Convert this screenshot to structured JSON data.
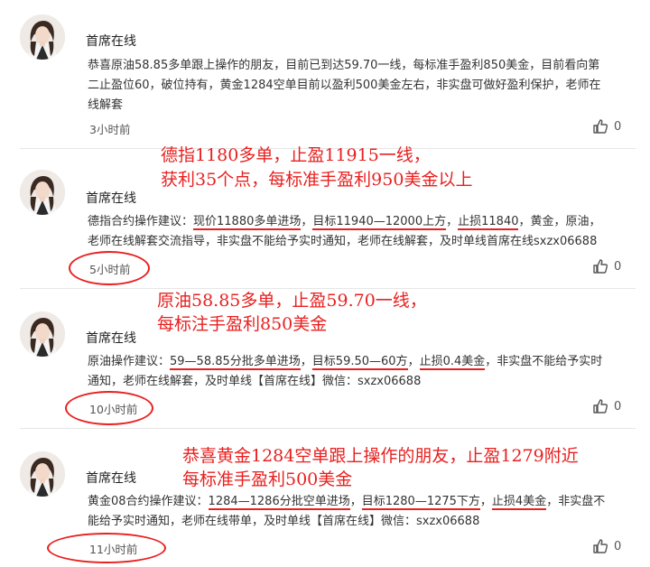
{
  "posts": [
    {
      "author": "首席在线",
      "lines": [
        "恭喜原油58.85多单跟上操作的朋友，目前已到达59.70一线，每标准手盈利850美金，目前看向第",
        "二止盈位60，破位持有，黄金1284空单目前以盈利500美金左右，非实盘可做好盈利保护，老师在",
        "线解套"
      ],
      "time": "3小时前",
      "likes": "0"
    },
    {
      "author": "首席在线",
      "annotation": [
        "德指1180多单，止盈11915一线，",
        "获利35个点，每标准手盈利950美金以上"
      ],
      "line1": {
        "a": "德指合约操作建议：",
        "u1": "现价11880多单进场",
        "b": "，",
        "u2": "目标11940—12000上方",
        "c": "，",
        "u3": "止损11840",
        "d": "，黄金，原油，"
      },
      "line2": "老师在线解套交流指导，非实盘不能给予实时通知，老师在线解套，及时单线首席在线sxzx06688",
      "time": "5小时前",
      "likes": "0"
    },
    {
      "author": "首席在线",
      "annotation": [
        "原油58.85多单，止盈59.70一线，",
        "每标注手盈利850美金"
      ],
      "line1": {
        "a": "原油操作建议：",
        "u1": "59—58.85分批多单进场",
        "b": "，",
        "u2": "目标59.50—60方",
        "c": "，",
        "u3": "止损0.4美金",
        "d": "，非实盘不能给予实时"
      },
      "line2": "通知，老师在线解套，及时单线【首席在线】微信：sxzx06688",
      "time": "10小时前",
      "likes": "0"
    },
    {
      "author": "首席在线",
      "annotation": [
        "恭喜黄金1284空单跟上操作的朋友，止盈1279附近",
        "每标准手盈利500美金"
      ],
      "line1": {
        "a": "黄金08合约操作建议：",
        "u1": "1284—1286分批空单进场",
        "b": "，",
        "u2": "目标1280—1275下方",
        "c": "，",
        "u3": "止损4美金",
        "d": "，非实盘不"
      },
      "line2": "能给予实时通知，老师在线带单，及时单线【首席在线】微信：sxzx06688",
      "time": "11小时前",
      "likes": "0"
    }
  ],
  "colors": {
    "annotation": "#e8201f",
    "text": "#333333",
    "divider": "#e6e6e6"
  },
  "icons": {
    "like": "thumbs-up-icon",
    "avatar": "user-avatar-photo"
  }
}
